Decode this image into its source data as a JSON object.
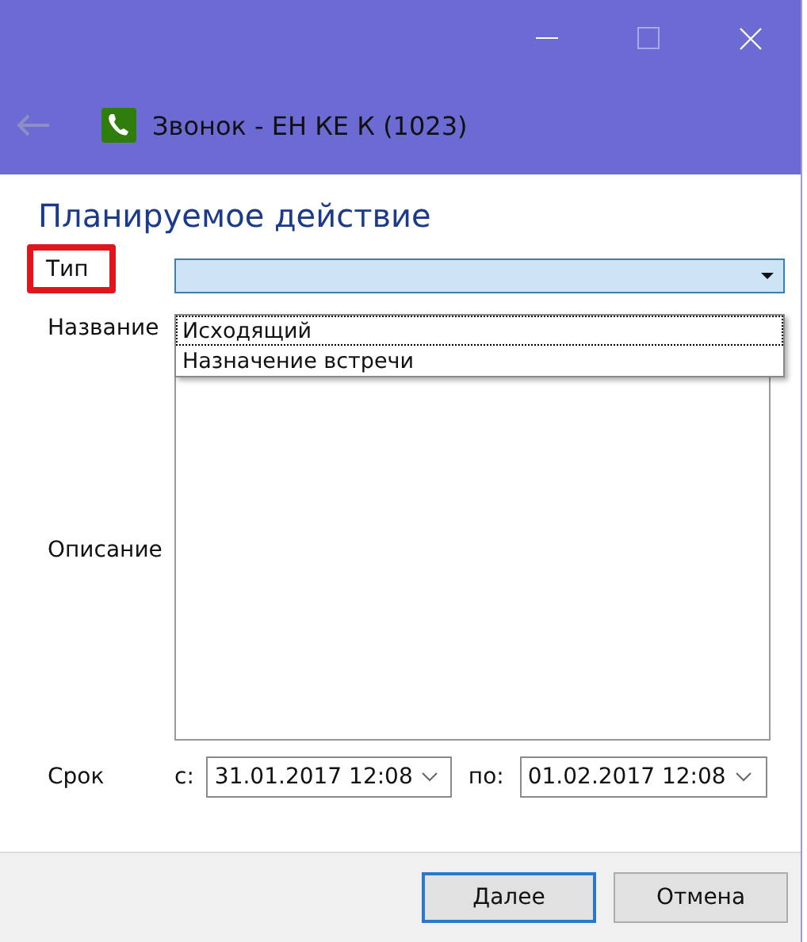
{
  "header": {
    "title": "Звонок - ЕН КЕ К  (1023)"
  },
  "heading": "Планируемое действие",
  "form": {
    "type": {
      "label": "Тип",
      "highlighted": true,
      "expanded": true,
      "options": [
        {
          "label": "Исходящий",
          "selected": true
        },
        {
          "label": "Назначение встречи",
          "selected": false
        }
      ]
    },
    "name": {
      "label": "Название"
    },
    "description": {
      "label": "Описание"
    },
    "due": {
      "label": "Срок",
      "from_label": "с:",
      "from_value": "31.01.2017 12:08",
      "to_label": "по:",
      "to_value": "01.02.2017 12:08"
    }
  },
  "buttons": [
    {
      "label": "Далее",
      "focused": true
    },
    {
      "label": "Отмена",
      "focused": false
    }
  ]
}
